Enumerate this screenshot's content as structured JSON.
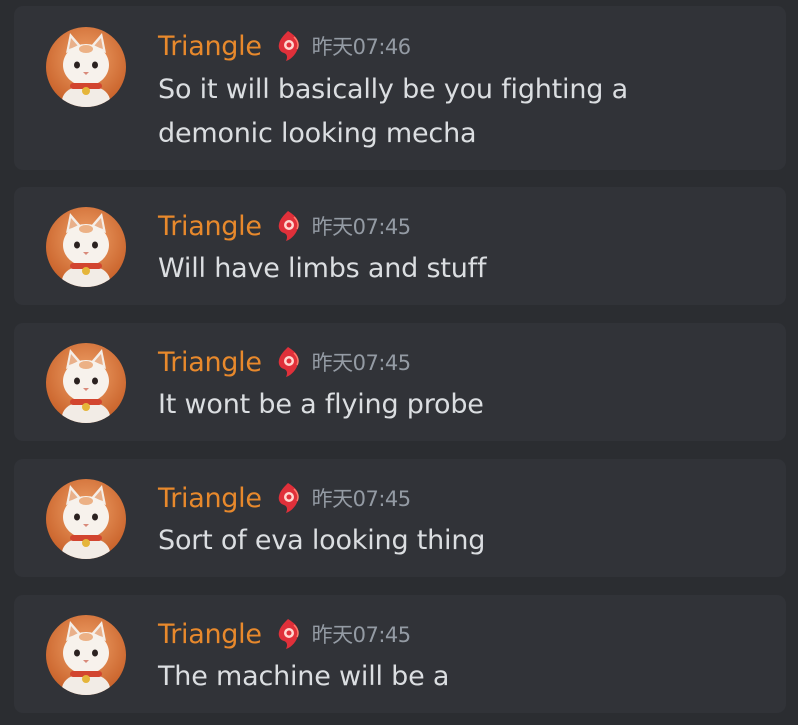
{
  "messages": [
    {
      "author": "Triangle",
      "author_color": "#e8892c",
      "badge_icon": "red-flame-emblem-icon",
      "timestamp": "昨天07:46",
      "lines": [
        "So it will basically be you fighting a",
        "demonic looking mecha"
      ]
    },
    {
      "author": "Triangle",
      "author_color": "#e8892c",
      "badge_icon": "red-flame-emblem-icon",
      "timestamp": "昨天07:45",
      "lines": [
        "Will have limbs and stuff"
      ]
    },
    {
      "author": "Triangle",
      "author_color": "#e8892c",
      "badge_icon": "red-flame-emblem-icon",
      "timestamp": "昨天07:45",
      "lines": [
        "It wont be a flying probe"
      ]
    },
    {
      "author": "Triangle",
      "author_color": "#e8892c",
      "badge_icon": "red-flame-emblem-icon",
      "timestamp": "昨天07:45",
      "lines": [
        "Sort of eva looking thing"
      ]
    },
    {
      "author": "Triangle",
      "author_color": "#e8892c",
      "badge_icon": "red-flame-emblem-icon",
      "timestamp": "昨天07:45",
      "lines": [
        "The machine will be a"
      ]
    }
  ]
}
